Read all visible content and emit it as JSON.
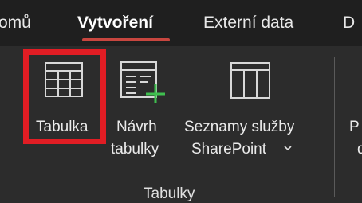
{
  "tabs": [
    {
      "label": "omů"
    },
    {
      "label": "Vytvoření"
    },
    {
      "label": "Externí data"
    },
    {
      "label": "D"
    }
  ],
  "ribbon": {
    "commands": [
      {
        "label_line1": "Tabulka",
        "label_line2": "",
        "icon": "table-icon"
      },
      {
        "label_line1": "Návrh",
        "label_line2": "tabulky",
        "icon": "table-design-icon"
      },
      {
        "label_line1": "Seznamy služby",
        "label_line2": "SharePoint",
        "icon": "sharepoint-list-icon",
        "has_dropdown": true
      },
      {
        "label_line1": "P",
        "label_line2": "d",
        "icon": ""
      }
    ],
    "group_label": "Tabulky"
  },
  "colors": {
    "background": "#1f1f1f",
    "ribbon": "#2c2c2c",
    "accent_underline": "#c8463f",
    "highlight_box": "#e11d24",
    "icon_green": "#3fbf4f"
  }
}
